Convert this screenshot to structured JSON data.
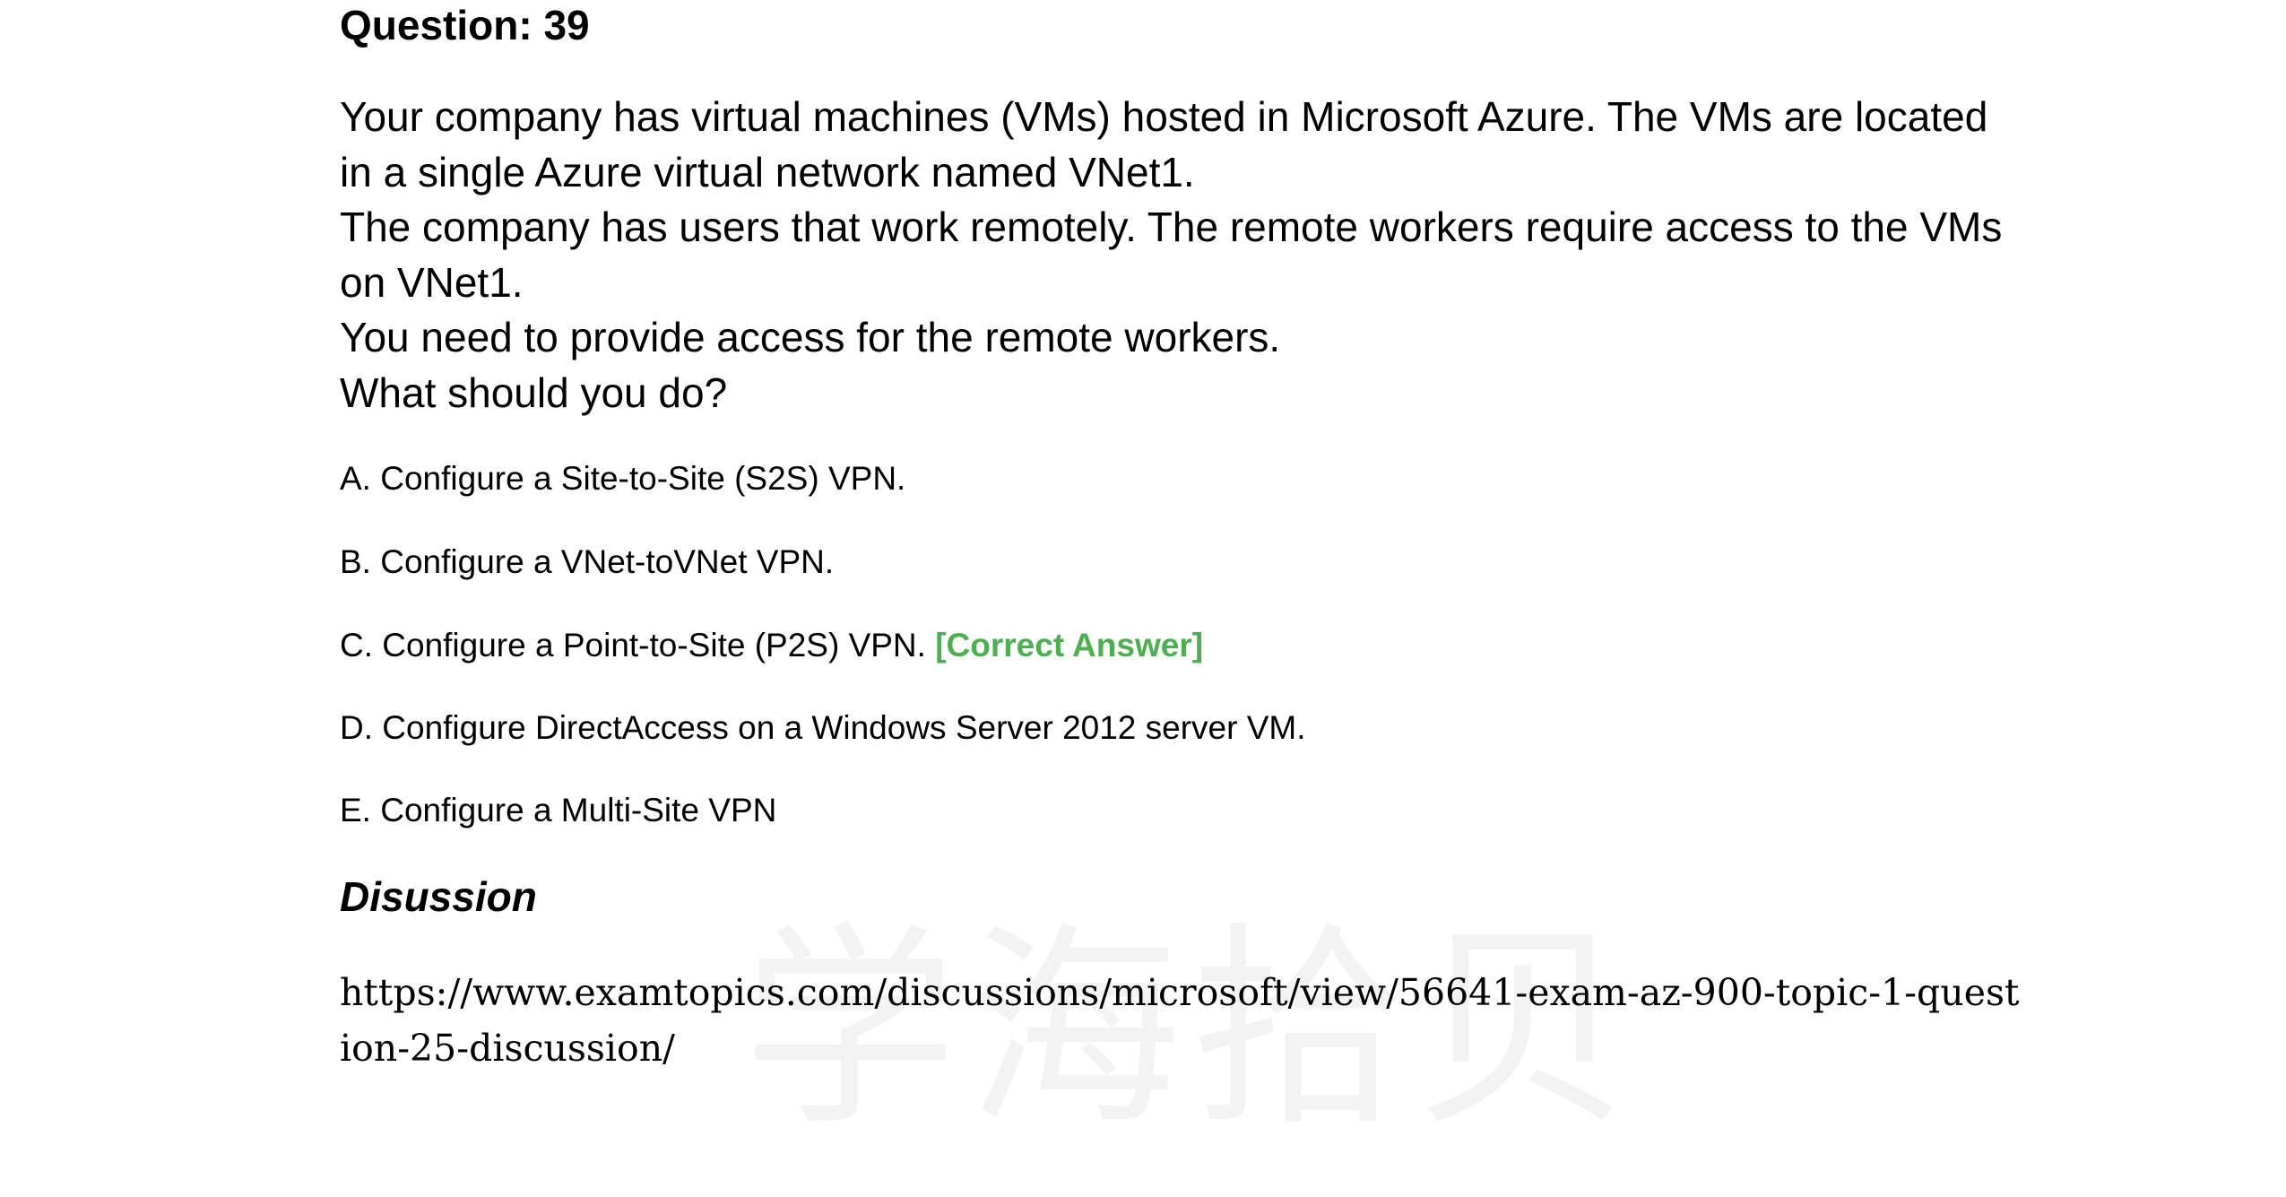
{
  "question": {
    "title": "Question: 39",
    "stem": [
      "Your company has virtual machines (VMs) hosted in Microsoft Azure. The VMs are located in a single Azure virtual network named VNet1.",
      "The company has users that work remotely. The remote workers require access to the VMs on VNet1.",
      "You need to provide access for the remote workers.",
      "What should you do?"
    ]
  },
  "options": [
    {
      "text": "A. Configure a Site-to-Site (S2S) VPN."
    },
    {
      "text": "B. Configure a VNet-toVNet VPN."
    },
    {
      "text": "C. Configure a Point-to-Site (P2S) VPN.",
      "tag": "[Correct Answer]"
    },
    {
      "text": "D. Configure DirectAccess on a Windows Server 2012 server VM."
    },
    {
      "text": "E. Configure a Multi-Site VPN"
    }
  ],
  "discussion": {
    "heading": "Disussion",
    "link": "https://www.examtopics.com/discussions/microsoft/view/56641-exam-az-900-topic-1-question-25-discussion/"
  },
  "watermark": "学海拾贝",
  "colors": {
    "correct_answer": "#4caf50",
    "text": "#000000",
    "background": "#ffffff"
  }
}
